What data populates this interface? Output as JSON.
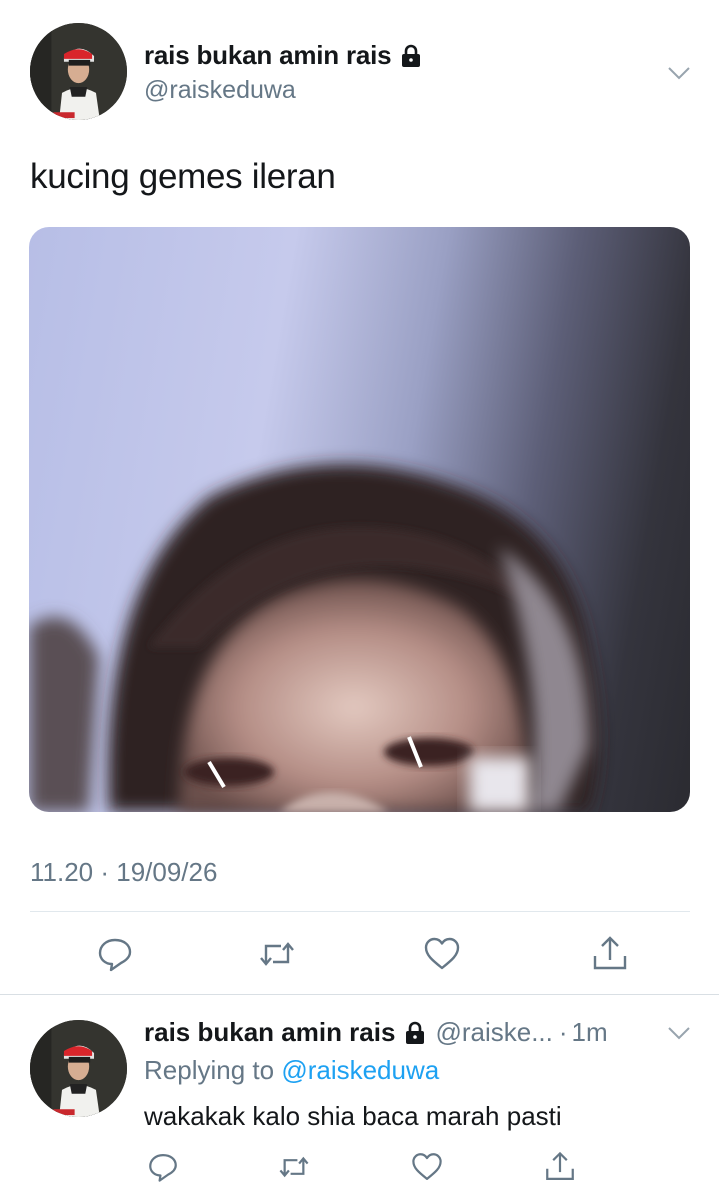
{
  "tweet": {
    "author_name": "rais bukan amin rais",
    "author_handle": "@raiskeduwa",
    "text": "kucing gemes ileran",
    "timestamp": "11.20 · 19/09/26",
    "icons": {
      "lock": "lock-icon",
      "chevron": "chevron-down-icon",
      "reply": "reply-icon",
      "retweet": "retweet-icon",
      "like": "heart-icon",
      "share": "share-icon"
    }
  },
  "reply": {
    "author_name": "rais bukan amin rais",
    "author_handle": "@raiske...",
    "separator": "·",
    "time": "1m",
    "replying_to_prefix": "Replying to",
    "replying_to_handle": "@raiskeduwa",
    "text": "wakakak kalo shia baca marah pasti"
  },
  "colors": {
    "text": "#14171a",
    "secondary": "#657786",
    "link": "#1da1f2",
    "divider": "#e1e8ed"
  }
}
